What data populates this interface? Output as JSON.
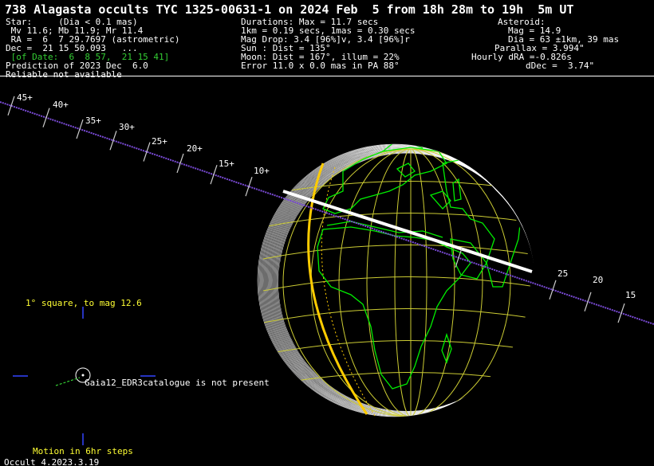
{
  "title": "738 Alagasta occults TYC 1325-00631-1 on 2024 Feb  5 from 18h 28m to 19h  5m UT",
  "header_left": [
    "Star:     (Dia < 0.1 mas)",
    " Mv 11.6; Mb 11.9; Mr 11.4",
    " RA =  6  7 29.7697 (astrometric)",
    "Dec =  21 15 50.093   ...",
    " [of Date:  6  8 57,  21 15 41]",
    "Prediction of 2023 Dec  6.0",
    "Reliable not available"
  ],
  "header_mid": [
    "Durations: Max = 11.7 secs",
    "1km = 0.19 secs, 1mas = 0.30 secs",
    "Mag Drop: 3.4 [96%]v, 3.4 [96%]r",
    "Sun : Dist = 135°",
    "Moon: Dist = 167°, illum = 22%",
    "Error 11.0 x 0.0 mas in PA 88°"
  ],
  "header_right": [
    "Asteroid:",
    "Mag = 14.9",
    "Dia = 63 ±1km, 39 mas",
    "Parallax = 3.994\"",
    "Hourly dRA =-0.826s",
    "dDec =  3.74\""
  ],
  "track_ticks_left": [
    "45+",
    "40+",
    "35+",
    "30+",
    "25+",
    "20+",
    "15+",
    "10+"
  ],
  "track_ticks_right": [
    "25",
    "20",
    "15"
  ],
  "finder_label": "1° square, to mag 12.6",
  "catalogue_note": "Gaia12_EDR3catalogue is not present",
  "motion_label": "Motion in 6hr steps",
  "version": "Occult 4.2023.3.19",
  "colors": {
    "background": "#000000",
    "coastline": "#00ee00",
    "graticule": "#cccc33",
    "path": "#ffffff",
    "track": "#7a4bd6",
    "terminator": "#ffcc00",
    "accent_text_green": "#33cc33",
    "accent_text_yellow": "#ffff33"
  }
}
